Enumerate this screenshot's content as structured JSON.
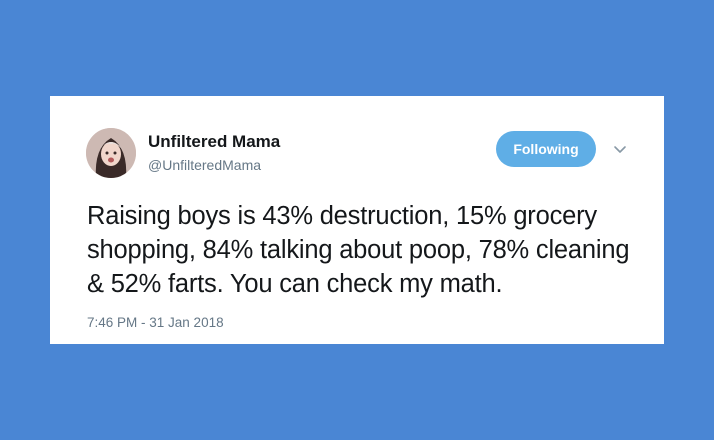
{
  "tweet": {
    "author_name": "Unfiltered Mama",
    "author_handle": "@UnfilteredMama",
    "follow_button_label": "Following",
    "text": "Raising boys is 43% destruction, 15% grocery shopping, 84% talking about poop, 78% cleaning & 52% farts. You can check my math.",
    "timestamp": "7:46 PM - 31 Jan 2018"
  },
  "colors": {
    "background": "#4a86d4",
    "card": "#ffffff",
    "follow_button": "#5faee6",
    "secondary_text": "#657786"
  }
}
